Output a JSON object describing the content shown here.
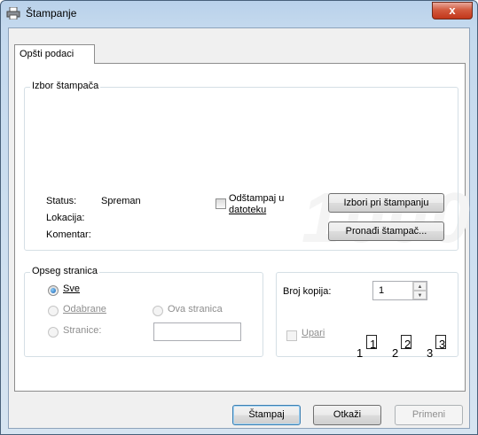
{
  "window": {
    "title": "Štampanje",
    "close_glyph": "x"
  },
  "tabs": [
    {
      "label": "Opšti podaci"
    }
  ],
  "printer_group": {
    "title": "Izbor štampača",
    "status_label": "Status:",
    "status_value": "Spreman",
    "location_label": "Lokacija:",
    "comment_label": "Komentar:",
    "print_to_file_label_1": "Odštampaj u",
    "print_to_file_label_2": "datoteku",
    "preferences_button": "Izbori pri štampanju",
    "find_printer_button": "Pronađi štampač..."
  },
  "page_range": {
    "title": "Opseg stranica",
    "all": "Sve",
    "selection": "Odabrane",
    "current_page": "Ova stranica",
    "pages": "Stranice:",
    "pages_value": ""
  },
  "copies": {
    "label": "Broj kopija:",
    "value": "1",
    "collate_label": "Upari",
    "collate_pages": [
      "1",
      "1",
      "2",
      "2",
      "3",
      "3"
    ]
  },
  "footer": {
    "print_button": "Štampaj",
    "cancel_button": "Otkaži",
    "apply_button": "Primeni"
  }
}
